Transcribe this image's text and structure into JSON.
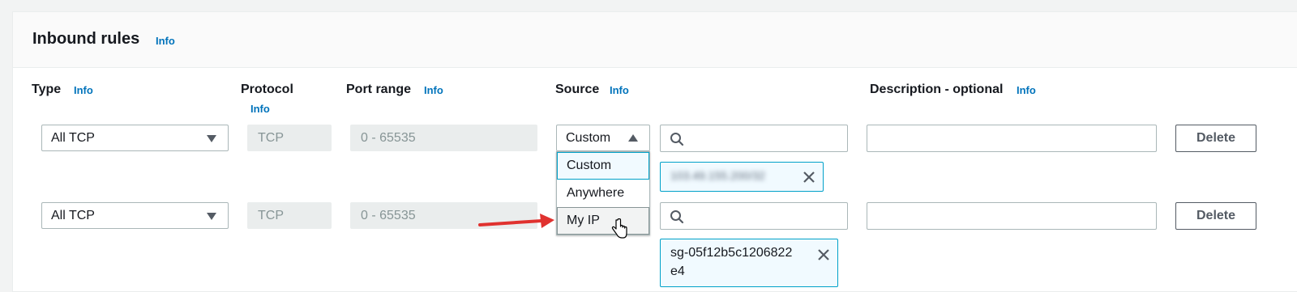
{
  "header": {
    "title": "Inbound rules",
    "info": "Info"
  },
  "columns": {
    "type": {
      "label": "Type",
      "info": "Info"
    },
    "protocol": {
      "label": "Protocol",
      "info": "Info"
    },
    "port_range": {
      "label": "Port range",
      "info": "Info"
    },
    "source": {
      "label": "Source",
      "info": "Info"
    },
    "description": {
      "label": "Description - optional",
      "info": "Info"
    }
  },
  "rows": [
    {
      "type": "All TCP",
      "protocol": "TCP",
      "port_range": "0 - 65535",
      "source": "Custom",
      "source_token": "103.49.155.200/32",
      "delete_label": "Delete"
    },
    {
      "type": "All TCP",
      "protocol": "TCP",
      "port_range": "0 - 65535",
      "source_token_line1": "sg-05f12b5c1206822",
      "source_token_line2": "e4",
      "delete_label": "Delete"
    }
  ],
  "source_menu": {
    "options": [
      "Custom",
      "Anywhere",
      "My IP"
    ],
    "selected": "Custom",
    "hovered": "My IP"
  },
  "colors": {
    "info_link": "#0073bb",
    "token_border": "#00a1c9",
    "arrow": "#e0322f"
  }
}
